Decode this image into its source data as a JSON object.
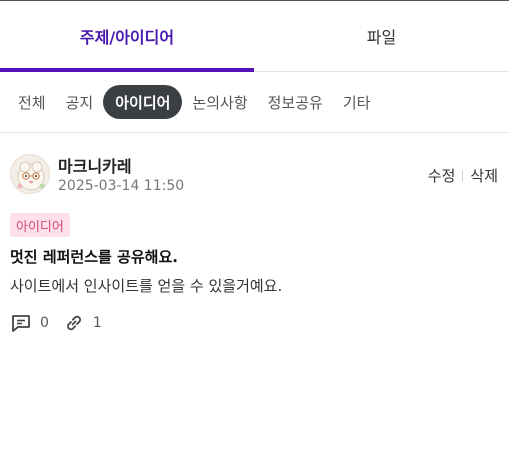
{
  "tabs": [
    {
      "label": "주제/아이디어",
      "active": true
    },
    {
      "label": "파일",
      "active": false
    }
  ],
  "filters": [
    {
      "label": "전체",
      "active": false
    },
    {
      "label": "공지",
      "active": false
    },
    {
      "label": "아이디어",
      "active": true
    },
    {
      "label": "논의사항",
      "active": false
    },
    {
      "label": "정보공유",
      "active": false
    },
    {
      "label": "기타",
      "active": false
    }
  ],
  "post": {
    "author": "마크니카레",
    "timestamp": "2025-03-14 11:50",
    "edit_label": "수정",
    "delete_label": "삭제",
    "category": "아이디어",
    "title": "멋진 레퍼런스를 공유해요.",
    "body": "사이트에서 인사이트를 얻을 수 있을거예요.",
    "comment_count": "0",
    "link_count": "1",
    "icons": {
      "comments": "comment-icon",
      "links": "link-icon"
    }
  },
  "colors": {
    "accent": "#5512b8",
    "active_chip_bg": "#3b3f44",
    "badge_bg": "#fde0ea",
    "badge_text": "#d44b7f"
  }
}
